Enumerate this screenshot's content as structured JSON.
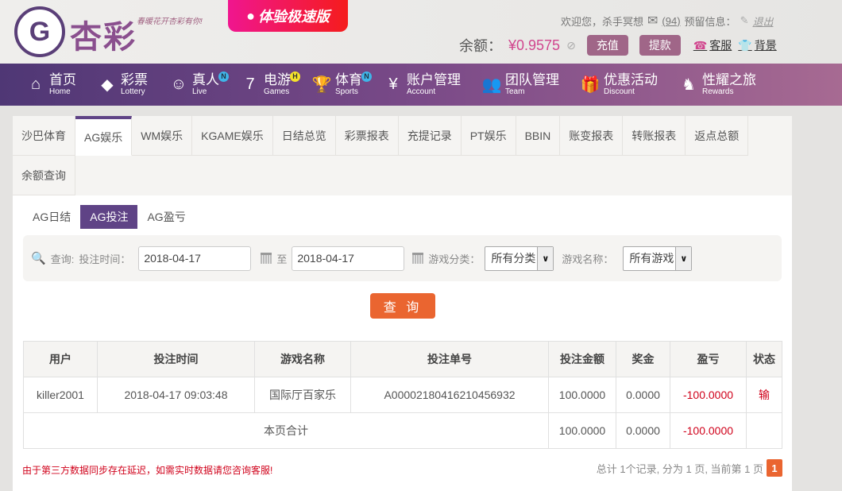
{
  "header": {
    "logo_text": "杏彩",
    "slogan": "春暖花开杏彩有你!",
    "speed_button": "体验极速版",
    "welcome": "欢迎您，杀手冥想",
    "messages": "(94)",
    "reserve_info": "预留信息：",
    "logout": "退出",
    "balance_label": "余额：",
    "balance": "¥0.9575",
    "recharge": "充值",
    "withdraw": "提款",
    "service": "客服",
    "background": "背景"
  },
  "nav": [
    {
      "cn": "首页",
      "en": "Home",
      "icon": "⌂"
    },
    {
      "cn": "彩票",
      "en": "Lottery",
      "icon": "◆"
    },
    {
      "cn": "真人",
      "en": "Live",
      "icon": "☺",
      "badge": "N"
    },
    {
      "cn": "电游",
      "en": "Games",
      "icon": "7",
      "badge": "H"
    },
    {
      "cn": "体育",
      "en": "Sports",
      "icon": "🏆",
      "badge": "N"
    },
    {
      "cn": "账户管理",
      "en": "Account",
      "icon": "¥"
    },
    {
      "cn": "团队管理",
      "en": "Team",
      "icon": "👥"
    },
    {
      "cn": "优惠活动",
      "en": "Discount",
      "icon": "🎁"
    },
    {
      "cn": "性耀之旅",
      "en": "Rewards",
      "icon": "♞"
    }
  ],
  "tabs": [
    "沙巴体育",
    "AG娱乐",
    "WM娱乐",
    "KGAME娱乐",
    "日结总览",
    "彩票报表",
    "充提记录",
    "PT娱乐",
    "BBIN",
    "账变报表",
    "转账报表",
    "返点总额",
    "余额查询"
  ],
  "subtabs": [
    "AG日结",
    "AG投注",
    "AG盈亏"
  ],
  "filter": {
    "query_label": "查询:",
    "time_label": "投注时间：",
    "from": "2018-04-17",
    "to_label": "至",
    "to": "2018-04-17",
    "category_label": "游戏分类：",
    "category": "所有分类",
    "game_label": "游戏名称：",
    "game": "所有游戏",
    "button": "查 询"
  },
  "table": {
    "headers": [
      "用户",
      "投注时间",
      "游戏名称",
      "投注单号",
      "投注金额",
      "奖金",
      "盈亏",
      "状态"
    ],
    "rows": [
      [
        "killer2001",
        "2018-04-17 09:03:48",
        "国际厅百家乐",
        "A00002180416210456932",
        "100.0000",
        "0.0000",
        "-100.0000",
        "输"
      ]
    ],
    "total": {
      "label": "本页合计",
      "amount": "100.0000",
      "bonus": "0.0000",
      "profit": "-100.0000"
    }
  },
  "footer": {
    "note": "由于第三方数据同步存在延迟，如需实时数据请您咨询客服!",
    "summary": "总计 1个记录, 分为 1 页, 当前第 1 页",
    "page": "1"
  }
}
